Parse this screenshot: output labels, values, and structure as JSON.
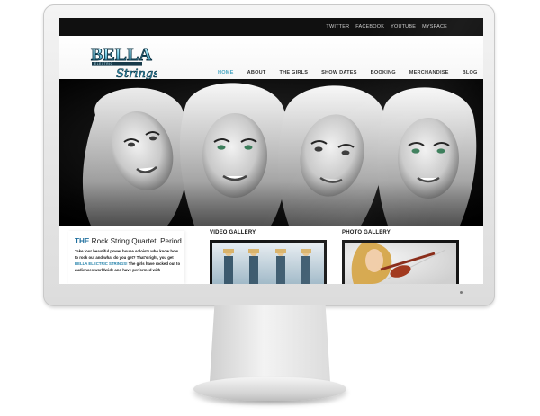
{
  "site": {
    "logo_text_main": "BELLA",
    "logo_text_sub": "ELECTRIC",
    "logo_text_script": "Strings"
  },
  "social": {
    "links": [
      "TWITTER",
      "FACEBOOK",
      "YOUTUBE",
      "MYSPACE"
    ]
  },
  "nav": {
    "items": [
      {
        "label": "HOME",
        "active": true
      },
      {
        "label": "ABOUT",
        "active": false
      },
      {
        "label": "THE GIRLS",
        "active": false
      },
      {
        "label": "SHOW DATES",
        "active": false
      },
      {
        "label": "BOOKING",
        "active": false
      },
      {
        "label": "MERCHANDISE",
        "active": false
      },
      {
        "label": "BLOG",
        "active": false
      }
    ]
  },
  "intro": {
    "tagline_highlight": "THE",
    "tagline_rest": " Rock String Quartet, Period.",
    "body_1": "Take four  beautiful power house soloists who know how to rock out and what do you get? That's right, you get ",
    "body_brand": "BELLA ELECTRIC STRINGS!",
    "body_2": " The girls have rocked out to audiences worldwide and have performed with"
  },
  "gallery": {
    "video_title": "VIDEO GALLERY",
    "photo_title": "PHOTO GALLERY"
  },
  "colors": {
    "accent": "#4aa6c2",
    "brand_blue": "#1f6f9e",
    "social_bar": "#101010"
  }
}
